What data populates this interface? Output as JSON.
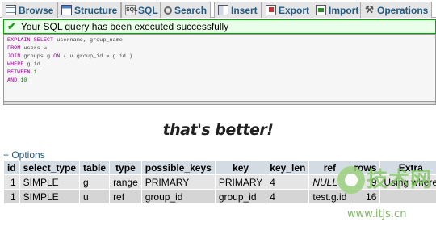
{
  "tabs": [
    {
      "label": "Browse",
      "icon": "browse-icon"
    },
    {
      "label": "Structure",
      "icon": "structure-icon"
    },
    {
      "label": "SQL",
      "icon": "sql-icon"
    },
    {
      "label": "Search",
      "icon": "search-icon"
    },
    {
      "label": "Insert",
      "icon": "insert-icon"
    },
    {
      "label": "Export",
      "icon": "export-icon"
    },
    {
      "label": "Import",
      "icon": "import-icon"
    },
    {
      "label": "Operations",
      "icon": "operations-icon"
    }
  ],
  "message": {
    "text": "Your SQL query has been executed successfully",
    "color": "#00aa00"
  },
  "sql": {
    "l1_kw1": "EXPLAIN",
    "l1_kw2": "SELECT",
    "l1_rest": " username, group_name",
    "l2_kw": "FROM",
    "l2_rest": " users u",
    "l3_kw1": "JOIN",
    "l3_mid": " groups g ",
    "l3_kw2": "ON",
    "l3_rest": " ( u.group_id = g.id )",
    "l4_kw": "WHERE",
    "l4_rest": " g.id",
    "l5_kw": "BETWEEN",
    "l5_num": "1",
    "l6_kw": "AND",
    "l6_num": "10"
  },
  "caption": "that's better!",
  "options_link": "+ Options",
  "table": {
    "headers": [
      "id",
      "select_type",
      "table",
      "type",
      "possible_keys",
      "key",
      "key_len",
      "ref",
      "rows",
      "Extra"
    ],
    "rows": [
      [
        "1",
        "SIMPLE",
        "g",
        "range",
        "PRIMARY",
        "PRIMARY",
        "4",
        "NULL",
        "9",
        "Using where"
      ],
      [
        "1",
        "SIMPLE",
        "u",
        "ref",
        "group_id",
        "group_id",
        "4",
        "test.g.id",
        "16",
        ""
      ]
    ]
  },
  "watermark": {
    "text": "技术网",
    "url": "www.itjs.cn"
  }
}
